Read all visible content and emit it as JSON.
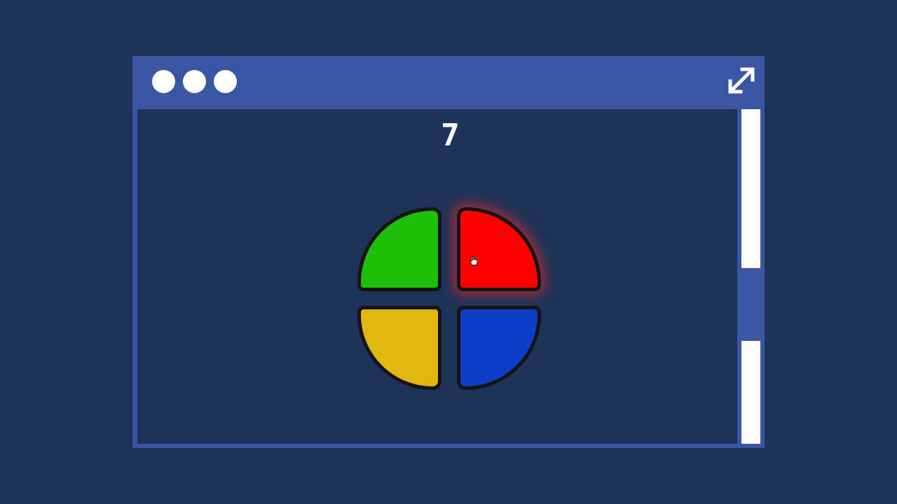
{
  "window": {
    "frame_color": "#3a55a4",
    "background_color": "#1e3357",
    "controls": [
      {
        "name": "window-dot-1",
        "icon": "circle"
      },
      {
        "name": "window-dot-2",
        "icon": "circle"
      },
      {
        "name": "window-dot-3",
        "icon": "circle"
      }
    ],
    "expand_icon": "expand-arrows-icon"
  },
  "game": {
    "score": "7",
    "pads": [
      {
        "name": "green-pad",
        "color": "#1dbf0b",
        "lit": false
      },
      {
        "name": "red-pad",
        "color": "#ff0000",
        "lit": true
      },
      {
        "name": "yellow-pad",
        "color": "#e0b70d",
        "lit": false
      },
      {
        "name": "blue-pad",
        "color": "#0e3ec8",
        "lit": false
      }
    ]
  },
  "cursor": {
    "icon": "hand-pointer-icon"
  }
}
